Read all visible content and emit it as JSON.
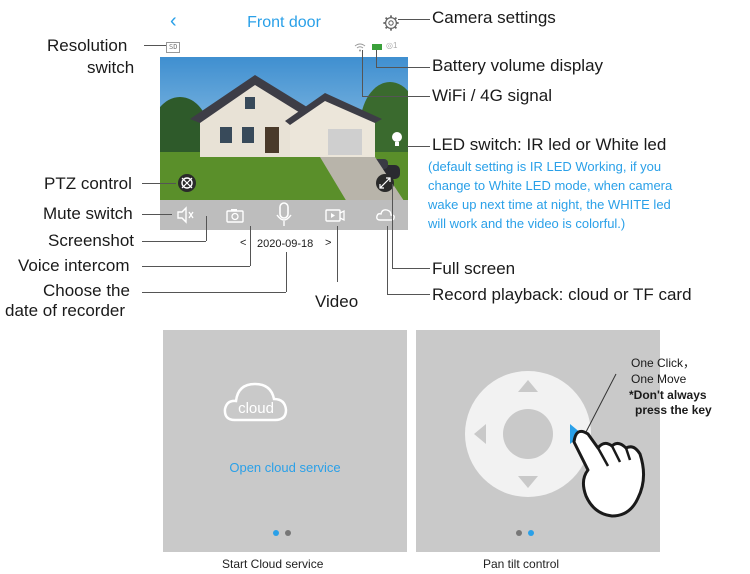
{
  "phone": {
    "back_icon": "chevron-left-icon",
    "title": "Front door",
    "settings_icon": "gear-icon",
    "resolution_badge": "SD",
    "battery_level_text": "1",
    "date": "2020-09-18",
    "date_prev": "<",
    "date_next": ">",
    "controls": [
      "mute-icon",
      "camera-icon",
      "microphone-icon",
      "video-icon",
      "cloud-icon"
    ]
  },
  "annotations": {
    "camera_settings": "Camera settings",
    "resolution_1": "Resolution",
    "resolution_2": "switch",
    "battery": "Battery volume display",
    "wifi": "WiFi / 4G signal",
    "led_switch": "LED switch: IR led or White led",
    "led_note_1": "(default setting is IR LED Working, if you",
    "led_note_2": "change to White LED mode, when camera",
    "led_note_3": "wake up next time at night, the WHITE led",
    "led_note_4": "will work and the video is colorful.)",
    "ptz": "PTZ control",
    "mute": "Mute switch",
    "screenshot": "Screenshot",
    "voice": "Voice intercom",
    "choose_1": "Choose the",
    "choose_2": "date of recorder",
    "full_screen": "Full screen",
    "video": "Video",
    "record": "Record playback: cloud or TF card"
  },
  "cloud_panel": {
    "icon_label": "cloud",
    "link": "Open cloud service",
    "caption": "Start Cloud service"
  },
  "ptz_panel": {
    "note_1": "One Click，",
    "note_2": "One Move",
    "note_3": "*Don't always",
    "note_4": "press the key",
    "caption": "Pan tilt control"
  },
  "colors": {
    "accent": "#2aa0e8",
    "panel_bg": "#c9c9c9",
    "control_bar": "#bdbdbd"
  }
}
